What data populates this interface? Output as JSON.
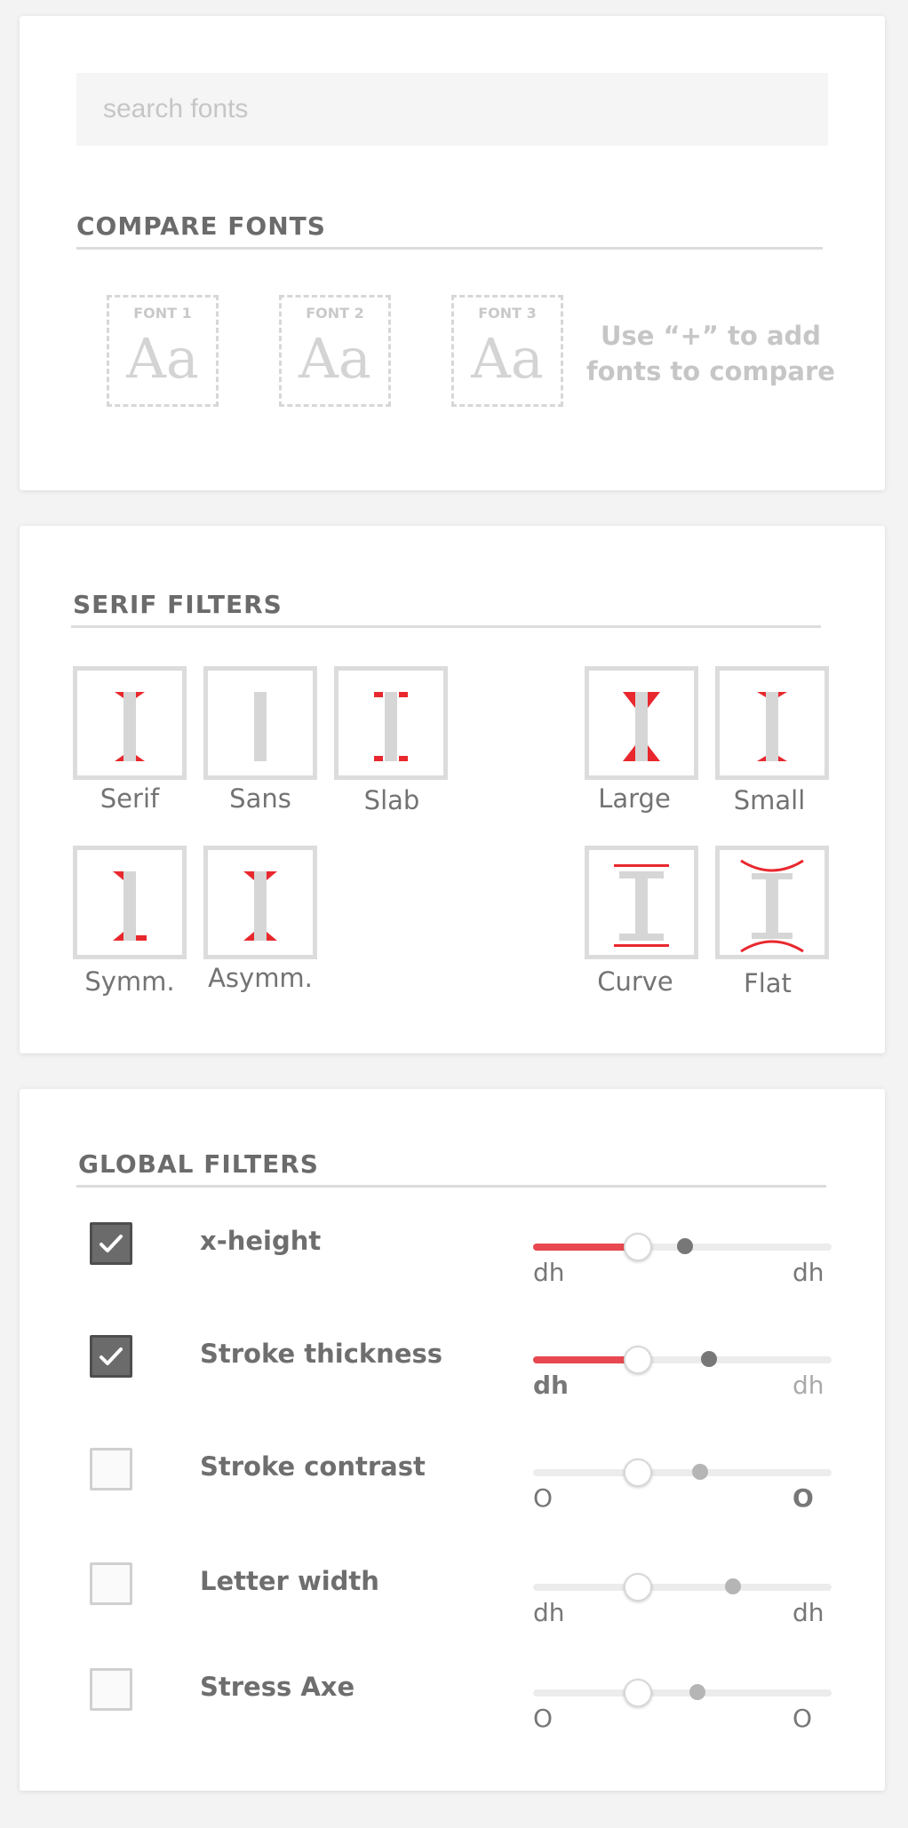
{
  "search": {
    "placeholder": "search fonts"
  },
  "compare": {
    "title": "COMPARE FONTS",
    "slots": [
      {
        "label": "FONT 1",
        "sample": "Aa"
      },
      {
        "label": "FONT 2",
        "sample": "Aa"
      },
      {
        "label": "FONT 3",
        "sample": "Aa"
      }
    ],
    "hint_line1": "Use “+” to add",
    "hint_line2": "fonts to compare"
  },
  "serif_filters": {
    "title": "SERIF FILTERS",
    "items": [
      {
        "label": "Serif",
        "icon": "serif-glyph-icon"
      },
      {
        "label": "Sans",
        "icon": "sans-glyph-icon"
      },
      {
        "label": "Slab",
        "icon": "slab-glyph-icon"
      },
      {
        "label": "Large",
        "icon": "large-serif-icon"
      },
      {
        "label": "Small",
        "icon": "small-serif-icon"
      },
      {
        "label": "Symm.",
        "icon": "symmetric-serif-icon"
      },
      {
        "label": "Asymm.",
        "icon": "asymmetric-serif-icon"
      },
      {
        "label": "Curve",
        "icon": "curve-serif-icon"
      },
      {
        "label": "Flat",
        "icon": "flat-serif-icon"
      }
    ],
    "accent_color": "#e8282e",
    "glyph_color": "#d6d6d6"
  },
  "global_filters": {
    "title": "GLOBAL FILTERS",
    "items": [
      {
        "label": "x-height",
        "checked": true,
        "min_label": "dh",
        "max_label": "dh",
        "level": 0.35,
        "marker": 0.51
      },
      {
        "label": "Stroke thickness",
        "checked": true,
        "min_label": "dh",
        "max_label": "dh",
        "level": 0.35,
        "marker": 0.59
      },
      {
        "label": "Stroke contrast",
        "checked": false,
        "min_label": "O",
        "max_label": "O",
        "level": 0.35,
        "marker": 0.56
      },
      {
        "label": "Letter width",
        "checked": false,
        "min_label": "dh",
        "max_label": "dh",
        "level": 0.35,
        "marker": 0.67
      },
      {
        "label": "Stress Axe",
        "checked": false,
        "min_label": "O",
        "max_label": "O",
        "level": 0.35,
        "marker": 0.55
      }
    ],
    "accent_color": "#e8484f"
  }
}
